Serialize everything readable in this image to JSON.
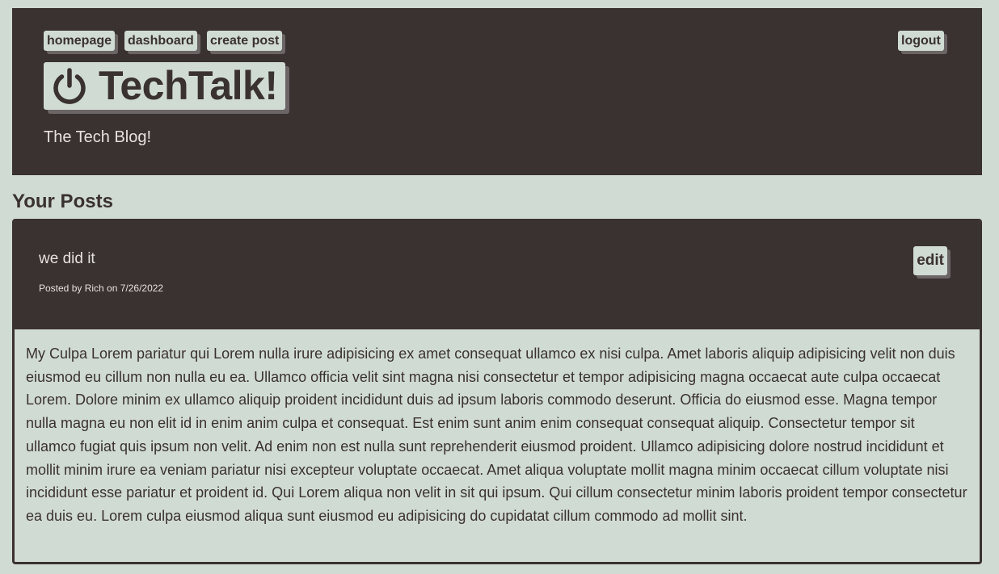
{
  "nav": {
    "homepage": "homepage",
    "dashboard": "dashboard",
    "create_post": "create post",
    "logout": "logout"
  },
  "brand": {
    "icon": "power-icon",
    "title": "TechTalk!",
    "subtitle": "The Tech Blog!"
  },
  "section_title": "Your Posts",
  "post": {
    "title": "we did it",
    "meta": "Posted by Rich on 7/26/2022",
    "edit_label": "edit",
    "body": "My Culpa Lorem pariatur qui Lorem nulla irure adipisicing ex amet consequat ullamco ex nisi culpa. Amet laboris aliquip adipisicing velit non duis eiusmod eu cillum non nulla eu ea. Ullamco officia velit sint magna nisi consectetur et tempor adipisicing magna occaecat aute culpa occaecat Lorem. Dolore minim ex ullamco aliquip proident incididunt duis ad ipsum laboris commodo deserunt. Officia do eiusmod esse. Magna tempor nulla magna eu non elit id in enim anim culpa et consequat. Est enim sunt anim enim consequat consequat aliquip. Consectetur tempor sit ullamco fugiat quis ipsum non velit. Ad enim non est nulla sunt reprehenderit eiusmod proident. Ullamco adipisicing dolore nostrud incididunt et mollit minim irure ea veniam pariatur nisi excepteur voluptate occaecat. Amet aliqua voluptate mollit magna minim occaecat cillum voluptate nisi incididunt esse pariatur et proident id. Qui Lorem aliqua non velit in sit qui ipsum. Qui cillum consectetur minim laboris proident tempor consectetur ea duis eu. Lorem culpa eiusmod aliqua sunt eiusmod eu adipisicing do cupidatat cillum commodo ad mollit sint."
  },
  "colors": {
    "background": "#d0dbd3",
    "dark": "#3a3131",
    "shadow": "#6b6565",
    "light_text": "#e5e1df"
  }
}
